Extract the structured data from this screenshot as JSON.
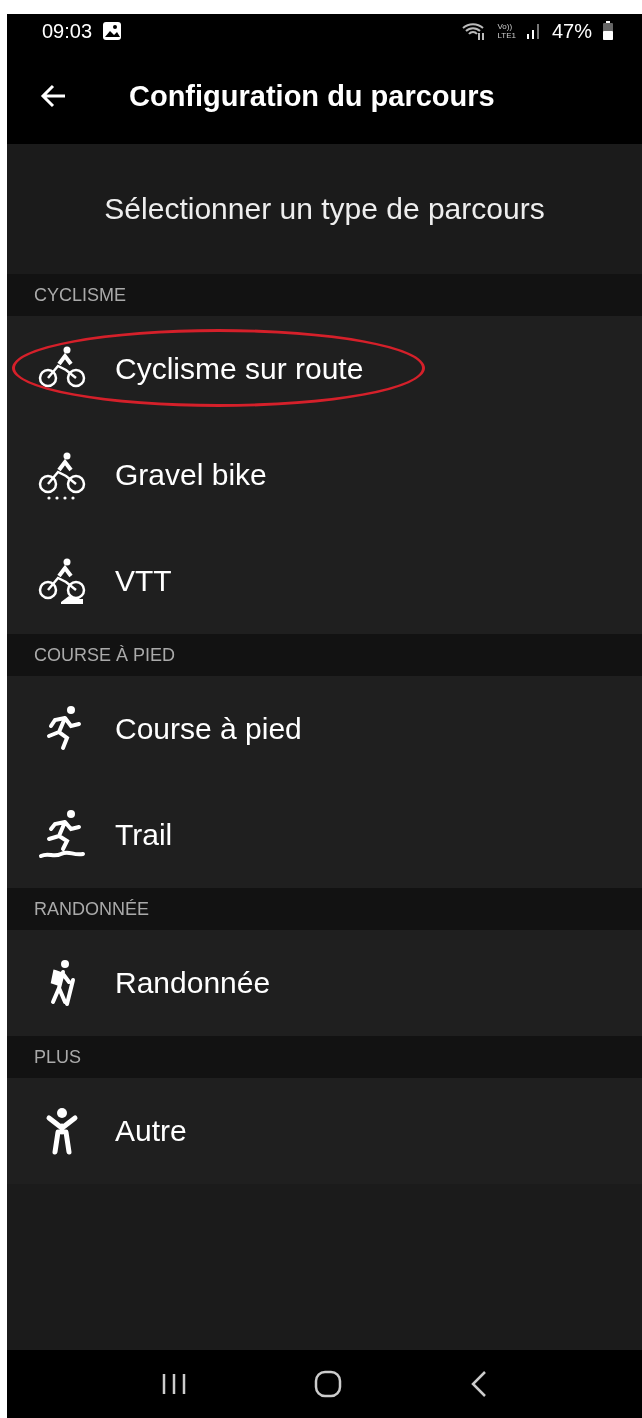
{
  "status_bar": {
    "time": "09:03",
    "battery": "47%",
    "network": "Vo))\nLTE1"
  },
  "header": {
    "title": "Configuration du parcours"
  },
  "heading": "Sélectionner un type de parcours",
  "sections": [
    {
      "label": "CYCLISME",
      "items": [
        {
          "label": "Cyclisme sur route",
          "kind": "road-bike",
          "highlighted": true
        },
        {
          "label": "Gravel bike",
          "kind": "gravel-bike",
          "highlighted": false
        },
        {
          "label": "VTT",
          "kind": "mountain-bike",
          "highlighted": false
        }
      ]
    },
    {
      "label": "COURSE À PIED",
      "items": [
        {
          "label": "Course à pied",
          "kind": "run",
          "highlighted": false
        },
        {
          "label": "Trail",
          "kind": "trail",
          "highlighted": false
        }
      ]
    },
    {
      "label": "RANDONNÉE",
      "items": [
        {
          "label": "Randonnée",
          "kind": "hike",
          "highlighted": false
        }
      ]
    },
    {
      "label": "PLUS",
      "items": [
        {
          "label": "Autre",
          "kind": "other",
          "highlighted": false
        }
      ]
    }
  ]
}
